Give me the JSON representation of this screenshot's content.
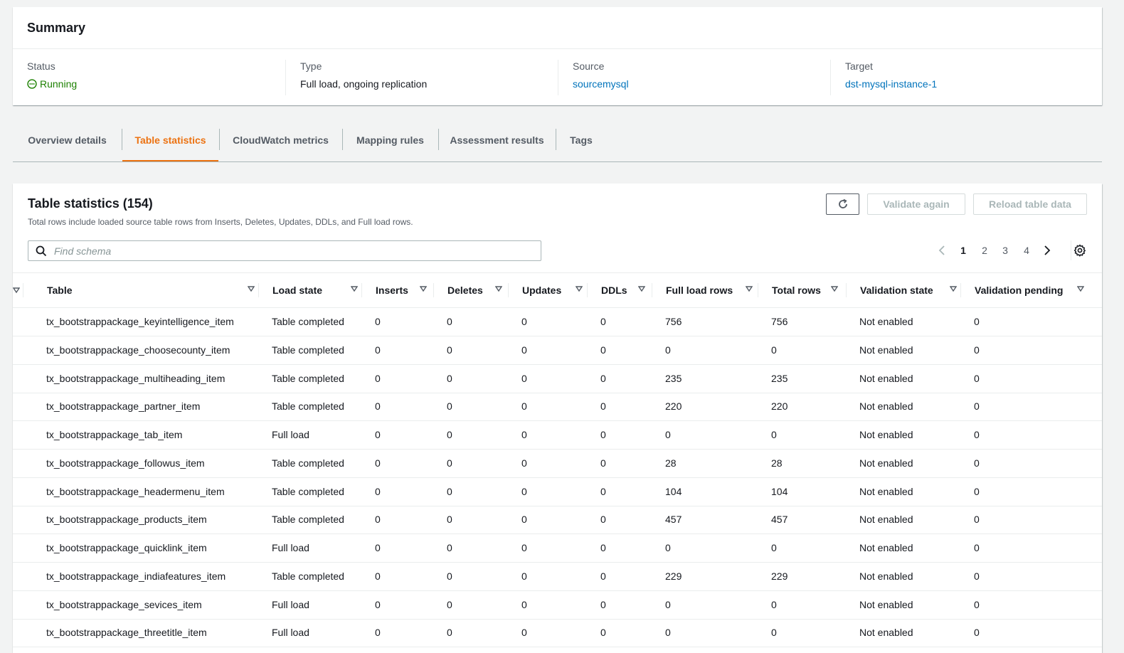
{
  "summary": {
    "title": "Summary",
    "status": {
      "label": "Status",
      "value": "Running"
    },
    "type": {
      "label": "Type",
      "value": "Full load, ongoing replication"
    },
    "source": {
      "label": "Source",
      "value": "sourcemysql"
    },
    "target": {
      "label": "Target",
      "value": "dst-mysql-instance-1"
    }
  },
  "tabs": [
    {
      "label": "Overview details",
      "active": false
    },
    {
      "label": "Table statistics",
      "active": true
    },
    {
      "label": "CloudWatch metrics",
      "active": false
    },
    {
      "label": "Mapping rules",
      "active": false
    },
    {
      "label": "Assessment results",
      "active": false
    },
    {
      "label": "Tags",
      "active": false
    }
  ],
  "panel": {
    "title": "Table statistics (154)",
    "description": "Total rows include loaded source table rows from Inserts, Deletes, Updates, DDLs, and Full load rows.",
    "buttons": {
      "validate": "Validate again",
      "reload": "Reload table data"
    },
    "search": {
      "placeholder": "Find schema"
    },
    "pagination": {
      "pages": [
        "1",
        "2",
        "3",
        "4"
      ],
      "current": "1"
    }
  },
  "table": {
    "columns": [
      "Table",
      "Load state",
      "Inserts",
      "Deletes",
      "Updates",
      "DDLs",
      "Full load rows",
      "Total rows",
      "Validation state",
      "Validation pending"
    ],
    "rows": [
      [
        "tx_bootstrappackage_keyintelligence_item",
        "Table completed",
        "0",
        "0",
        "0",
        "0",
        "756",
        "756",
        "Not enabled",
        "0"
      ],
      [
        "tx_bootstrappackage_choosecounty_item",
        "Table completed",
        "0",
        "0",
        "0",
        "0",
        "0",
        "0",
        "Not enabled",
        "0"
      ],
      [
        "tx_bootstrappackage_multiheading_item",
        "Table completed",
        "0",
        "0",
        "0",
        "0",
        "235",
        "235",
        "Not enabled",
        "0"
      ],
      [
        "tx_bootstrappackage_partner_item",
        "Table completed",
        "0",
        "0",
        "0",
        "0",
        "220",
        "220",
        "Not enabled",
        "0"
      ],
      [
        "tx_bootstrappackage_tab_item",
        "Full load",
        "0",
        "0",
        "0",
        "0",
        "0",
        "0",
        "Not enabled",
        "0"
      ],
      [
        "tx_bootstrappackage_followus_item",
        "Table completed",
        "0",
        "0",
        "0",
        "0",
        "28",
        "28",
        "Not enabled",
        "0"
      ],
      [
        "tx_bootstrappackage_headermenu_item",
        "Table completed",
        "0",
        "0",
        "0",
        "0",
        "104",
        "104",
        "Not enabled",
        "0"
      ],
      [
        "tx_bootstrappackage_products_item",
        "Table completed",
        "0",
        "0",
        "0",
        "0",
        "457",
        "457",
        "Not enabled",
        "0"
      ],
      [
        "tx_bootstrappackage_quicklink_item",
        "Full load",
        "0",
        "0",
        "0",
        "0",
        "0",
        "0",
        "Not enabled",
        "0"
      ],
      [
        "tx_bootstrappackage_indiafeatures_item",
        "Table completed",
        "0",
        "0",
        "0",
        "0",
        "229",
        "229",
        "Not enabled",
        "0"
      ],
      [
        "tx_bootstrappackage_sevices_item",
        "Full load",
        "0",
        "0",
        "0",
        "0",
        "0",
        "0",
        "Not enabled",
        "0"
      ],
      [
        "tx_bootstrappackage_threetitle_item",
        "Full load",
        "0",
        "0",
        "0",
        "0",
        "0",
        "0",
        "Not enabled",
        "0"
      ]
    ]
  }
}
